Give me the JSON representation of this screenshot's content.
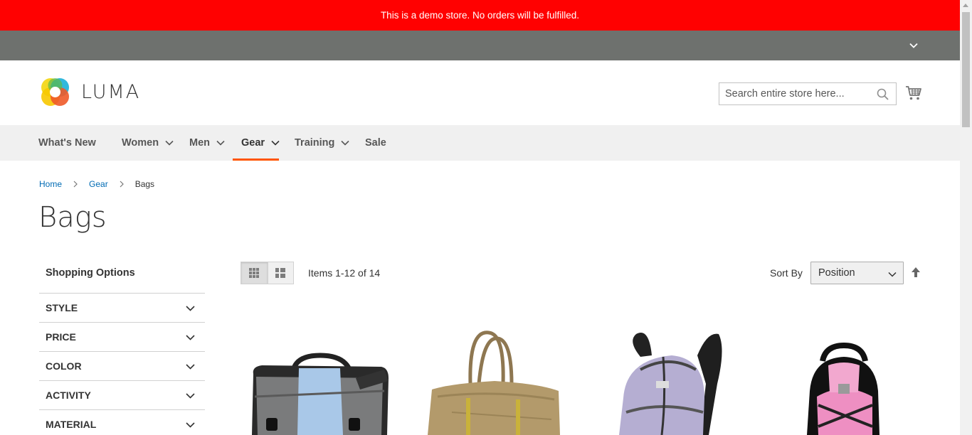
{
  "demo_notice": "This is a demo store. No orders will be fulfilled.",
  "header": {
    "logo_text": "LUMA",
    "search_placeholder": "Search entire store here..."
  },
  "nav": {
    "items": [
      {
        "label": "What's New",
        "has_submenu": false
      },
      {
        "label": "Women",
        "has_submenu": true
      },
      {
        "label": "Men",
        "has_submenu": true
      },
      {
        "label": "Gear",
        "has_submenu": true,
        "active": true
      },
      {
        "label": "Training",
        "has_submenu": true
      },
      {
        "label": "Sale",
        "has_submenu": false
      }
    ]
  },
  "breadcrumb": {
    "items": [
      {
        "label": "Home",
        "link": true
      },
      {
        "label": "Gear",
        "link": true
      },
      {
        "label": "Bags",
        "link": false
      }
    ]
  },
  "page_title": "Bags",
  "sidebar": {
    "title": "Shopping Options",
    "filters": [
      "Style",
      "Price",
      "Color",
      "Activity",
      "Material"
    ]
  },
  "toolbar": {
    "items_count": "Items 1-12 of 14",
    "sort_label": "Sort By",
    "sort_value": "Position",
    "view_modes": [
      "grid",
      "list"
    ],
    "active_mode": "grid"
  },
  "colors": {
    "demo_bar": "#ff0101",
    "panel_bar": "#6e716e",
    "nav_bg": "#f0f0f0",
    "nav_active": "#ff5501",
    "link": "#006bb4"
  },
  "products": [
    {
      "image": "messenger-bag-icon"
    },
    {
      "image": "tote-bag-icon"
    },
    {
      "image": "lavender-backpack-icon"
    },
    {
      "image": "pink-black-backpack-icon"
    }
  ]
}
